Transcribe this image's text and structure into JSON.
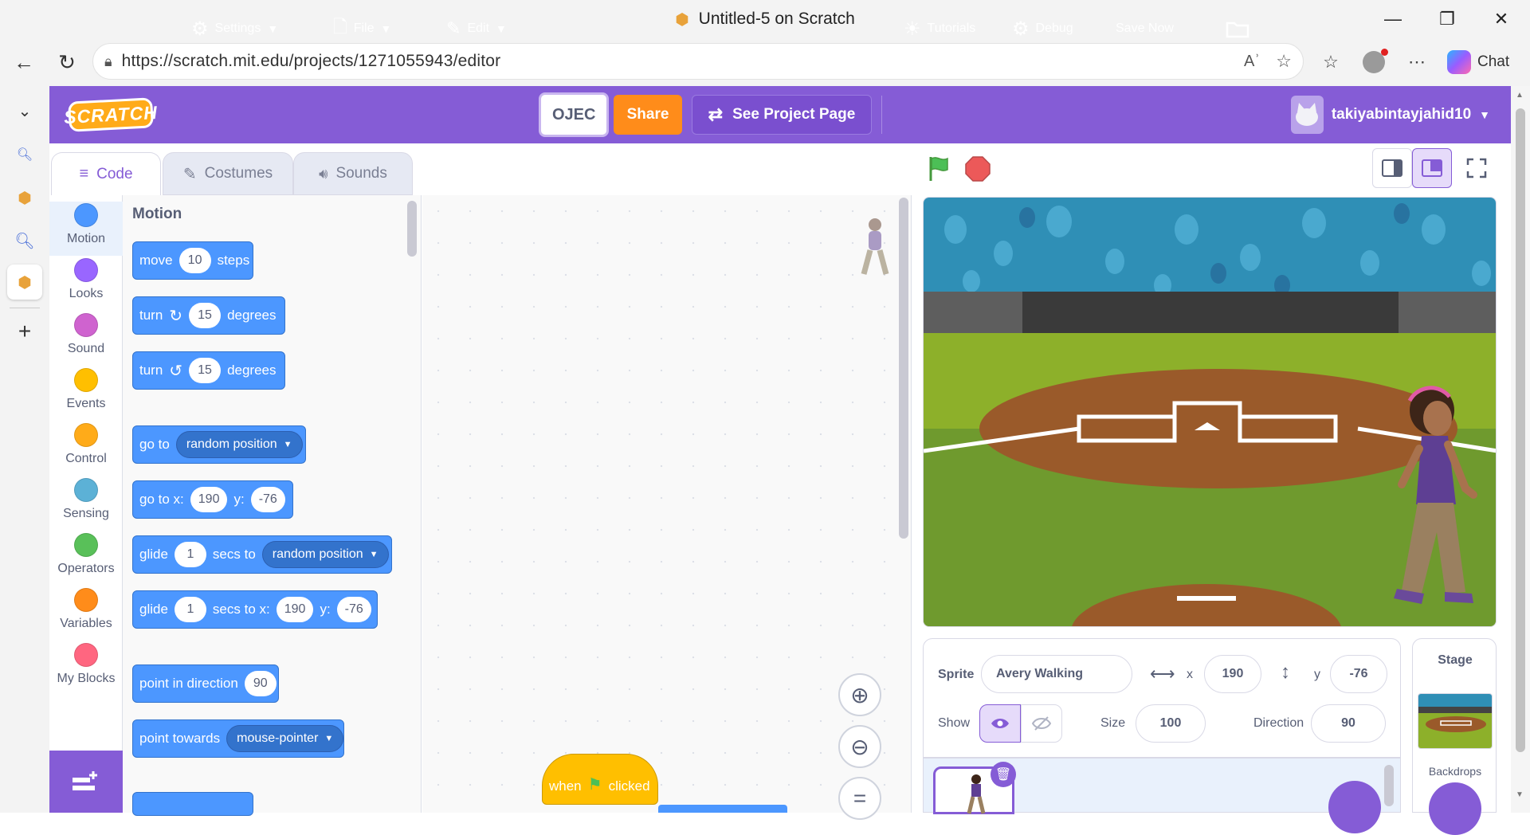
{
  "browser": {
    "window_title": "Untitled-5 on Scratch",
    "url": "https://scratch.mit.edu/projects/1271055943/editor",
    "chat_label": "Chat"
  },
  "menubar": {
    "logo_text": "SCRATCH",
    "settings": "Settings",
    "file": "File",
    "edit": "Edit",
    "project_title_value": "OJEC",
    "share": "Share",
    "see_project_page": "See Project Page",
    "tutorials": "Tutorials",
    "debug": "Debug",
    "save_now": "Save Now",
    "username": "takiyabintayjahid10"
  },
  "tabs": {
    "code": "Code",
    "costumes": "Costumes",
    "sounds": "Sounds"
  },
  "categories": [
    {
      "label": "Motion",
      "color": "#4c97ff"
    },
    {
      "label": "Looks",
      "color": "#9966ff"
    },
    {
      "label": "Sound",
      "color": "#cf63cf"
    },
    {
      "label": "Events",
      "color": "#ffbf00"
    },
    {
      "label": "Control",
      "color": "#ffab19"
    },
    {
      "label": "Sensing",
      "color": "#5cb1d6"
    },
    {
      "label": "Operators",
      "color": "#59c059"
    },
    {
      "label": "Variables",
      "color": "#ff8c1a"
    },
    {
      "label": "My Blocks",
      "color": "#ff6680"
    }
  ],
  "palette": {
    "heading": "Motion",
    "move": {
      "a": "move",
      "v": "10",
      "b": "steps"
    },
    "turn_right": {
      "a": "turn",
      "v": "15",
      "b": "degrees"
    },
    "turn_left": {
      "a": "turn",
      "v": "15",
      "b": "degrees"
    },
    "goto": {
      "a": "go to",
      "dd": "random position"
    },
    "goto_xy": {
      "a": "go to x:",
      "x": "190",
      "b": "y:",
      "y": "-76"
    },
    "glide": {
      "a": "glide",
      "v": "1",
      "b": "secs to",
      "dd": "random position"
    },
    "glide_xy": {
      "a": "glide",
      "v": "1",
      "b": "secs to x:",
      "x": "190",
      "c": "y:",
      "y": "-76"
    },
    "point_dir": {
      "a": "point in direction",
      "v": "90"
    },
    "point_towards": {
      "a": "point towards",
      "dd": "mouse-pointer"
    }
  },
  "script": {
    "hat_a": "when",
    "hat_b": "clicked"
  },
  "sprite_info": {
    "sprite_label": "Sprite",
    "sprite_name": "Avery Walking",
    "x_label": "x",
    "x": "190",
    "y_label": "y",
    "y": "-76",
    "show_label": "Show",
    "size_label": "Size",
    "size": "100",
    "direction_label": "Direction",
    "direction": "90"
  },
  "stage_panel": {
    "stage_label": "Stage",
    "backdrops_label": "Backdrops"
  },
  "colors": {
    "scratch_purple": "#855cd6",
    "share_orange": "#ff8c1a",
    "motion_blue": "#4c97ff",
    "events_yellow": "#ffbf00"
  }
}
